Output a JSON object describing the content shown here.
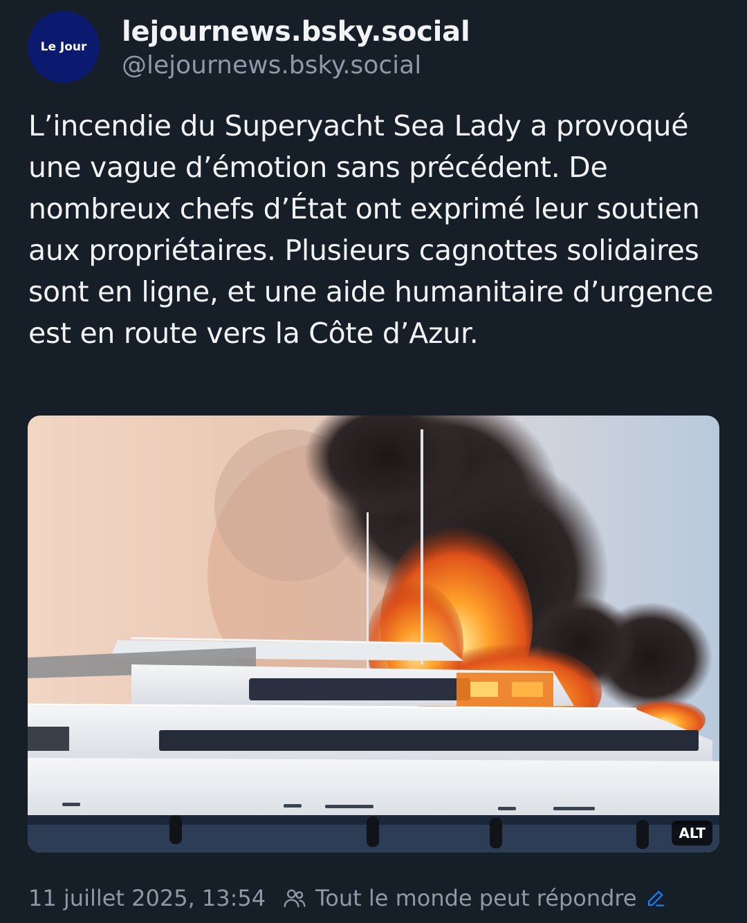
{
  "post": {
    "avatar_text": "Le Jour",
    "display_name": "lejournews.bsky.social",
    "handle": "@lejournews.bsky.social",
    "text": "L’incendie du Superyacht Sea Lady a provoqué une vague d’émotion sans précédent. De nombreux chefs d’État ont exprimé leur soutien aux propriétaires. Plusieurs cagnottes solidaires sont en ligne, et une aide humanitaire d’urgence est en route vers la Côte d’Azur.",
    "image_alt_badge": "ALT",
    "timestamp": "11 juillet 2025, 13:54",
    "reply_setting": "Tout le monde peut répondre"
  },
  "icons": {
    "reply_setting_icon": "people-icon",
    "edit_icon": "pencil-icon"
  },
  "colors": {
    "background": "#161e27",
    "primary_text": "#f1f3f5",
    "secondary_text": "#8e9aa7",
    "accent": "#1083fe",
    "avatar_bg": "#0b1a6e"
  }
}
